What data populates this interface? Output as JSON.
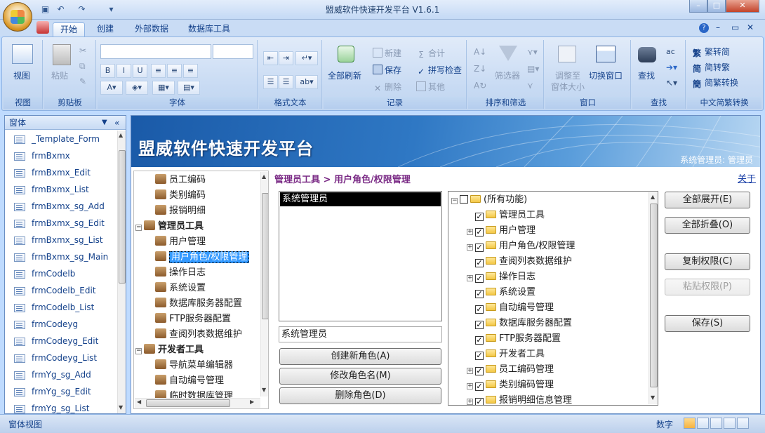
{
  "window": {
    "title": "盟威软件快速开发平台 V1.6.1",
    "minimize": "–",
    "maximize": "□",
    "close": "✕"
  },
  "ribbon_tabs": [
    "开始",
    "创建",
    "外部数据",
    "数据库工具"
  ],
  "ribbon_right": {
    "help": "?",
    "min": "–",
    "restore": "▭",
    "close": "✕"
  },
  "groups": {
    "view": {
      "label": "视图",
      "button": "视图"
    },
    "clipboard": {
      "label": "剪贴板",
      "paste": "粘贴"
    },
    "font": {
      "label": "字体"
    },
    "format": {
      "label": "格式文本"
    },
    "records": {
      "label": "记录",
      "refresh": "全部刷新",
      "new": "新建",
      "save": "保存",
      "delete": "删除",
      "sum": "合计",
      "spell": "拼写检查",
      "other": "其他"
    },
    "sort": {
      "label": "排序和筛选",
      "filter": "筛选器"
    },
    "window": {
      "label": "窗口",
      "fit": "调整至",
      "fit2": "窗体大小",
      "switch": "切换窗口"
    },
    "find": {
      "label": "查找",
      "find": "查找"
    },
    "chinese": {
      "label": "中文简繁转换",
      "t2s": "繁转简",
      "s2t": "简转繁",
      "convert": "简繁转换"
    }
  },
  "nav": {
    "header": "窗体",
    "items": [
      "_Template_Form",
      "frmBxmx",
      "frmBxmx_Edit",
      "frmBxmx_List",
      "frmBxmx_sg_Add",
      "frmBxmx_sg_Edit",
      "frmBxmx_sg_List",
      "frmBxmx_sg_Main",
      "frmCodelb",
      "frmCodelb_Edit",
      "frmCodelb_List",
      "frmCodeyg",
      "frmCodeyg_Edit",
      "frmCodeyg_List",
      "frmYg_sg_Add",
      "frmYg_sg_Edit",
      "frmYg_sg_List"
    ]
  },
  "banner": {
    "title": "盟威软件快速开发平台",
    "user": "系统管理员: 管理员"
  },
  "left_tree": [
    {
      "label": "员工编码",
      "level": 2
    },
    {
      "label": "类别编码",
      "level": 2
    },
    {
      "label": "报销明细",
      "level": 2
    },
    {
      "label": "管理员工具",
      "level": 1,
      "bold": true,
      "expander": "−"
    },
    {
      "label": "用户管理",
      "level": 2
    },
    {
      "label": "用户角色/权限管理",
      "level": 2,
      "selected": true
    },
    {
      "label": "操作日志",
      "level": 2
    },
    {
      "label": "系统设置",
      "level": 2
    },
    {
      "label": "数据库服务器配置",
      "level": 2
    },
    {
      "label": "FTP服务器配置",
      "level": 2
    },
    {
      "label": "查阅列表数据维护",
      "level": 2
    },
    {
      "label": "开发者工具",
      "level": 1,
      "bold": true,
      "expander": "−"
    },
    {
      "label": "导航菜单编辑器",
      "level": 2
    },
    {
      "label": "自动编号管理",
      "level": 2
    },
    {
      "label": "临时数据库管理",
      "level": 2
    }
  ],
  "breadcrumb": "管理员工具 > 用户角色/权限管理",
  "about": "关于",
  "roles": {
    "items": [
      "系统管理员"
    ],
    "name_value": "系统管理员"
  },
  "role_buttons": {
    "create": "创建新角色(A)",
    "rename": "修改角色名(M)",
    "delete": "删除角色(D)"
  },
  "permissions": [
    {
      "label": "(所有功能)",
      "level": 0,
      "expander": "−",
      "checked": false
    },
    {
      "label": "管理员工具",
      "level": 1,
      "expander": "",
      "checked": true
    },
    {
      "label": "用户管理",
      "level": 1,
      "expander": "+",
      "checked": true
    },
    {
      "label": "用户角色/权限管理",
      "level": 1,
      "expander": "+",
      "checked": true
    },
    {
      "label": "查阅列表数据维护",
      "level": 1,
      "expander": "",
      "checked": true
    },
    {
      "label": "操作日志",
      "level": 1,
      "expander": "+",
      "checked": true
    },
    {
      "label": "系统设置",
      "level": 1,
      "expander": "",
      "checked": true
    },
    {
      "label": "自动编号管理",
      "level": 1,
      "expander": "",
      "checked": true
    },
    {
      "label": "数据库服务器配置",
      "level": 1,
      "expander": "",
      "checked": true
    },
    {
      "label": "FTP服务器配置",
      "level": 1,
      "expander": "",
      "checked": true
    },
    {
      "label": "开发者工具",
      "level": 1,
      "expander": "",
      "checked": true
    },
    {
      "label": "员工编码管理",
      "level": 1,
      "expander": "+",
      "checked": true
    },
    {
      "label": "类别编码管理",
      "level": 1,
      "expander": "+",
      "checked": true
    },
    {
      "label": "报销明细信息管理",
      "level": 1,
      "expander": "+",
      "checked": true
    }
  ],
  "perm_buttons": {
    "expand": "全部展开(E)",
    "collapse": "全部折叠(O)",
    "copy": "复制权限(C)",
    "paste": "粘贴权限(P)",
    "save": "保存(S)"
  },
  "status": {
    "left": "窗体视图",
    "mode": "数字"
  }
}
